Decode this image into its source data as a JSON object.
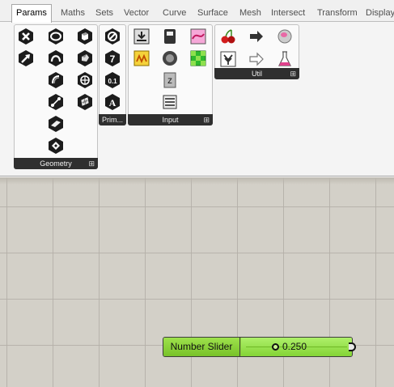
{
  "tabs": [
    "Params",
    "Maths",
    "Sets",
    "Vector",
    "Curve",
    "Surface",
    "Mesh",
    "Intersect",
    "Transform",
    "Display"
  ],
  "active_tab": "Params",
  "panels": {
    "geometry": {
      "label": "Geometry",
      "expander": "⊞"
    },
    "primitive": {
      "label": "Prim...",
      "expander": ""
    },
    "input": {
      "label": "Input",
      "expander": "⊞"
    },
    "util": {
      "label": "Util",
      "expander": "⊞"
    }
  },
  "icons": {
    "geometry": [
      "point-icon",
      "circle-icon",
      "box-icon",
      "vector-icon",
      "curve-icon",
      "brep-icon",
      "arc-icon",
      "surface-icon",
      "field-icon",
      "line-icon",
      "mesh-icon",
      "plane-icon",
      "group-icon",
      "geometry-param-icon"
    ],
    "primitive": [
      "boolean-icon",
      "integer-icon",
      "domain-icon",
      "text-icon"
    ],
    "input": [
      "data-input-icon",
      "panel-icon",
      "graph-mapper-icon",
      "button-icon",
      "boolean-toggle-icon",
      "colour-swatch-icon",
      "digit-scroller-icon",
      "image-sampler-icon",
      "list-item-icon"
    ],
    "util": [
      "cherry-picker-icon",
      "relay-arrow-icon",
      "jump-icon",
      "data-dam-icon",
      "hollow-arrow-icon",
      "flask-icon"
    ]
  },
  "canvas": {
    "slider": {
      "name": "Number Slider",
      "value": "0.250",
      "fraction": 0.25,
      "color": "#8ed23a"
    }
  },
  "colors": {
    "canvas_bg": "#d3d0c8",
    "panel_footer": "#2f2f2f",
    "slider_green": "#8ed23a"
  }
}
